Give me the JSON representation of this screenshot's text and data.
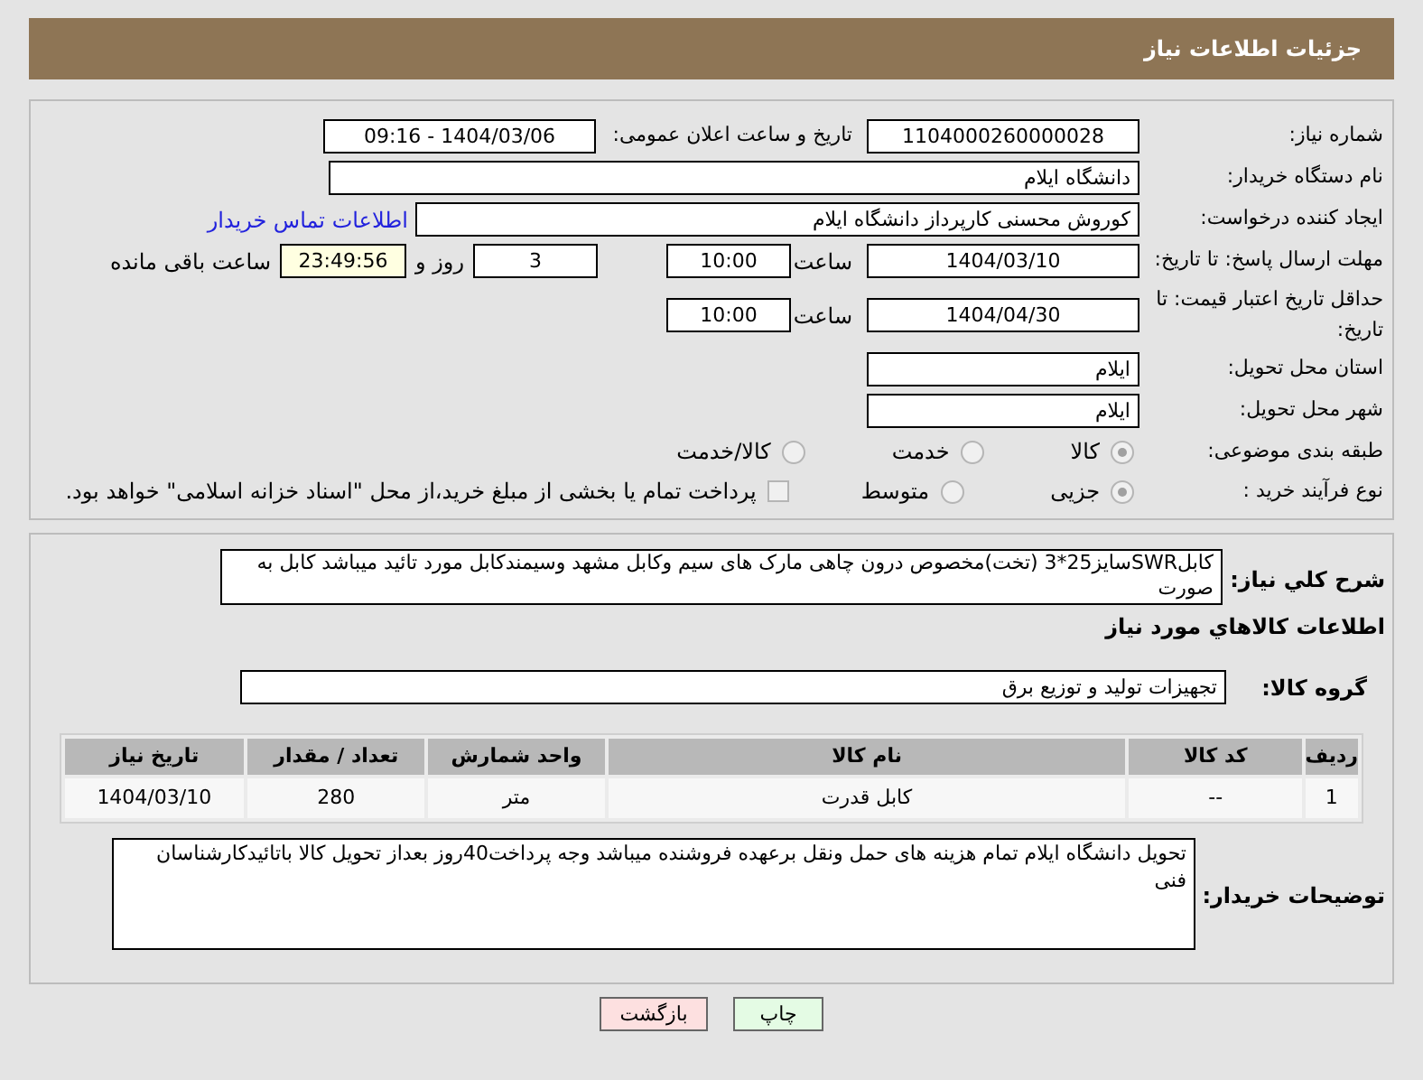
{
  "header": {
    "title": "جزئیات اطلاعات نیاز"
  },
  "need_number": {
    "label": "شماره نیاز:",
    "value": "1104000260000028"
  },
  "announce": {
    "label": "تاریخ و ساعت اعلان عمومی:",
    "value": "1404/03/06 - 09:16"
  },
  "buyer_org": {
    "label": "نام دستگاه خریدار:",
    "value": "دانشگاه ایلام"
  },
  "creator": {
    "label": "ایجاد کننده درخواست:",
    "value": "کوروش محسنی کارپرداز دانشگاه ایلام",
    "link": "اطلاعات تماس خریدار"
  },
  "reply_deadline": {
    "label": "مهلت ارسال پاسخ: تا تاریخ:",
    "date": "1404/03/10",
    "time_label": "ساعت",
    "time": "10:00",
    "days": "3",
    "days_label": "روز و",
    "remaining": "23:49:56",
    "remaining_label": "ساعت باقی مانده"
  },
  "price_validity": {
    "label": "حداقل تاریخ اعتبار قیمت: تا تاریخ:",
    "date": "1404/04/30",
    "time_label": "ساعت",
    "time": "10:00"
  },
  "province": {
    "label": "استان محل تحویل:",
    "value": "ایلام"
  },
  "city": {
    "label": "شهر محل تحویل:",
    "value": "ایلام"
  },
  "category": {
    "label": "طبقه بندی موضوعی:",
    "options": [
      {
        "label": "کالا",
        "selected": true
      },
      {
        "label": "خدمت",
        "selected": false
      },
      {
        "label": "کالا/خدمت",
        "selected": false
      }
    ]
  },
  "purchase_type": {
    "label": "نوع فرآیند خرید :",
    "options": [
      {
        "label": "جزیی",
        "selected": true
      },
      {
        "label": "متوسط",
        "selected": false
      }
    ],
    "treasury": {
      "label": "پرداخت تمام یا بخشی از مبلغ خرید،از محل \"اسناد خزانه اسلامی\" خواهد بود.",
      "checked": false
    }
  },
  "description": {
    "label": "شرح کلي نياز:",
    "value": "کابلSWRسایز25*3 (تخت)مخصوص درون چاهی مارک های سیم وکابل مشهد وسیمندکابل مورد تائید میباشد کابل به صورت"
  },
  "goods_title": "اطلاعات کالاهاي مورد نياز",
  "goods_group": {
    "label": "گروه کالا:",
    "value": "تجهیزات تولید و توزیع برق"
  },
  "table": {
    "columns": [
      "ردیف",
      "کد کالا",
      "نام کالا",
      "واحد شمارش",
      "تعداد / مقدار",
      "تاریخ نیاز"
    ],
    "rows": [
      [
        "1",
        "--",
        "کابل قدرت",
        "متر",
        "280",
        "1404/03/10"
      ]
    ]
  },
  "buyer_notes": {
    "label": "توضیحات خریدار:",
    "value": "تحویل دانشگاه ایلام تمام هزینه های حمل ونقل برعهده فروشنده میباشد وجه پرداخت40روز بعداز تحویل کالا باتائیدکارشناسان فنی"
  },
  "buttons": [
    {
      "kind": "print",
      "label": "چاپ"
    },
    {
      "kind": "back",
      "label": "بازگشت"
    }
  ]
}
